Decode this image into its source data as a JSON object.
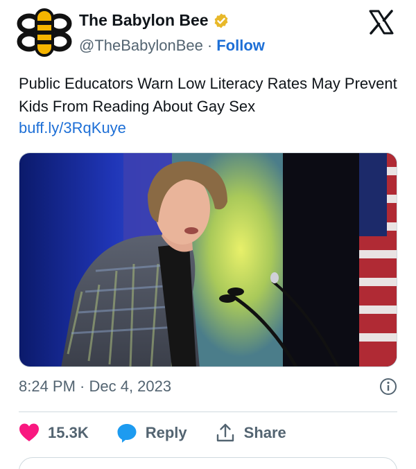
{
  "account": {
    "name": "The Babylon Bee",
    "handle": "@TheBabylonBee",
    "separator": "·",
    "follow_label": "Follow",
    "avatar_icon": "bee-logo-icon",
    "verified_icon": "verified-badge-icon"
  },
  "platform_icon": "x-logo-icon",
  "tweet": {
    "text": "Public Educators Warn Low Literacy Rates May Prevent Kids From Reading About Gay Sex",
    "link": "buff.ly/3RqKuye",
    "media_description_icon": "photo-speaker-at-podium"
  },
  "meta": {
    "timestamp": "8:24 PM · Dec 4, 2023",
    "info_icon": "info-icon"
  },
  "actions": {
    "like_count": "15.3K",
    "reply_label": "Reply",
    "share_label": "Share"
  },
  "colors": {
    "accent": "#1d6fd6",
    "like": "#f91880",
    "reply": "#1d9bf0",
    "muted": "#536471",
    "verified_gold": "#e8b829"
  }
}
